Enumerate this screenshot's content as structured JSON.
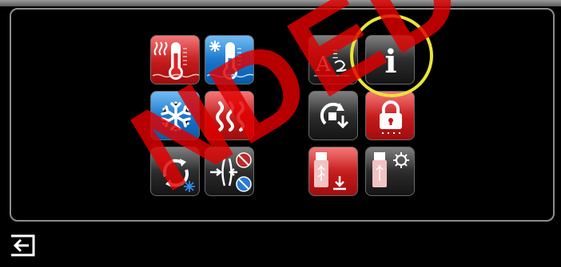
{
  "screen": {
    "watermark_text": "NDED",
    "colors": {
      "accent_ring": "#e9e43a",
      "hot": "#d92525",
      "cold": "#1f7fd6",
      "panel_border": "#8d8d8d"
    }
  },
  "tiles": [
    {
      "name": "heating-probe-tile",
      "icon": "thermometer-heat-icon"
    },
    {
      "name": "cooling-probe-tile",
      "icon": "thermometer-cold-icon"
    },
    {
      "name": "freeze-mode-tile",
      "icon": "snowflake-icon"
    },
    {
      "name": "heat-mode-tile",
      "icon": "heat-waves-icon"
    },
    {
      "name": "cycle-mode-tile",
      "icon": "heat-cool-cycle-icon"
    },
    {
      "name": "defrost-off-tile",
      "icon": "compress-off-icon"
    },
    {
      "name": "language-tile",
      "icon": "language-icon"
    },
    {
      "name": "info-tile",
      "icon": "info-icon"
    },
    {
      "name": "factory-reset-tile",
      "icon": "reset-icon"
    },
    {
      "name": "lock-tile",
      "icon": "lock-icon"
    },
    {
      "name": "usb-download-tile",
      "icon": "usb-download-icon"
    },
    {
      "name": "usb-settings-tile",
      "icon": "usb-settings-icon"
    }
  ],
  "info_tile_glyph": "i",
  "footer": {
    "back_icon": "back-arrow-icon"
  }
}
